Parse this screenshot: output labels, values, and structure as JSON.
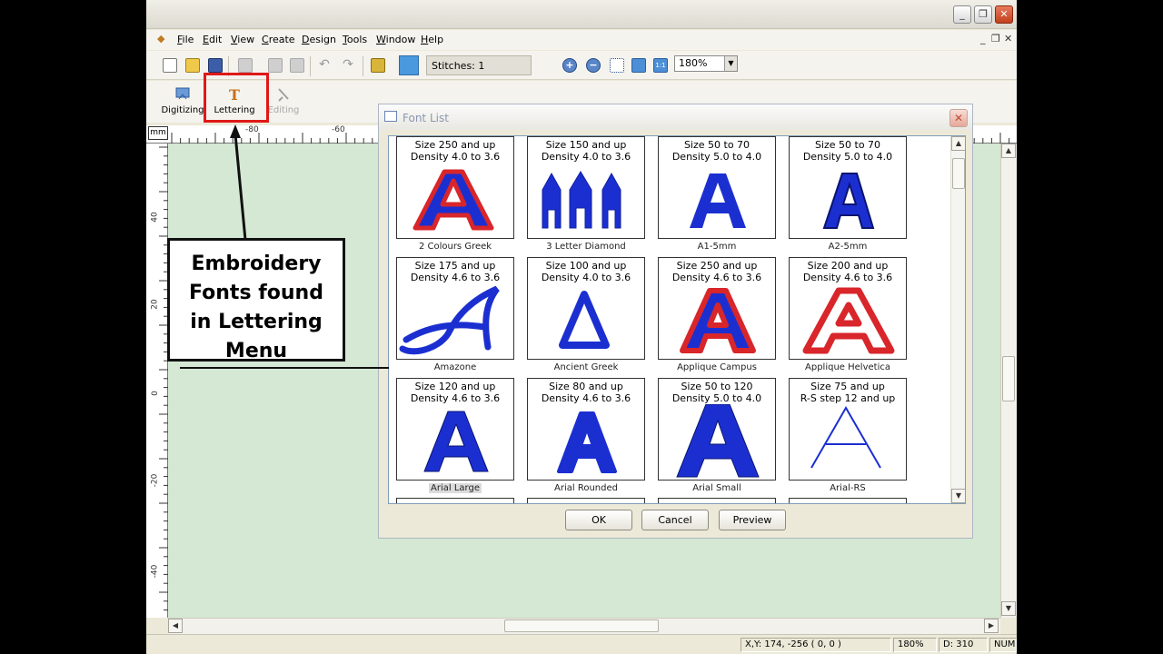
{
  "menu": [
    {
      "u": "F",
      "rest": "ile"
    },
    {
      "u": "E",
      "rest": "dit"
    },
    {
      "u": "V",
      "rest": "iew"
    },
    {
      "u": "C",
      "rest": "reate"
    },
    {
      "u": "D",
      "rest": "esign"
    },
    {
      "u": "T",
      "rest": "ools"
    },
    {
      "u": "W",
      "rest": "indow"
    },
    {
      "u": "H",
      "rest": "elp"
    }
  ],
  "toolbar": {
    "stitches_label": "Stitches: 1",
    "zoom": "180%"
  },
  "modes": [
    {
      "label": "Digitizing",
      "icon": "digitizing-icon"
    },
    {
      "label": "Lettering",
      "icon": "lettering-icon"
    },
    {
      "label": "Editing",
      "icon": "editing-icon"
    }
  ],
  "ruler": {
    "unit": "mm",
    "h_ticks": [
      "-80",
      "-60"
    ],
    "v_ticks": [
      "40",
      "20",
      "0",
      "-20",
      "-40"
    ]
  },
  "dialog": {
    "title": "Font List",
    "buttons": {
      "ok": "OK",
      "cancel": "Cancel",
      "preview": "Preview"
    },
    "fonts": [
      {
        "line1": "Size 250 and up",
        "line2": "Density 4.0 to 3.6",
        "name": "2 Colours Greek"
      },
      {
        "line1": "Size 150 and up",
        "line2": "Density 4.0 to 3.6",
        "name": "3 Letter Diamond"
      },
      {
        "line1": "Size 50 to 70",
        "line2": "Density 5.0 to 4.0",
        "name": "A1-5mm"
      },
      {
        "line1": "Size 50 to 70",
        "line2": "Density 5.0 to 4.0",
        "name": "A2-5mm"
      },
      {
        "line1": "Size 175 and up",
        "line2": "Density 4.6 to 3.6",
        "name": "Amazone"
      },
      {
        "line1": "Size 100 and up",
        "line2": "Density 4.0 to 3.6",
        "name": "Ancient Greek"
      },
      {
        "line1": "Size 250 and up",
        "line2": "Density 4.6 to 3.6",
        "name": "Applique Campus"
      },
      {
        "line1": "Size 200 and up",
        "line2": "Density 4.6 to 3.6",
        "name": "Applique Helvetica"
      },
      {
        "line1": "Size 120 and up",
        "line2": "Density 4.6 to 3.6",
        "name": "Arial Large"
      },
      {
        "line1": "Size 80 and up",
        "line2": "Density 4.6 to 3.6",
        "name": "Arial Rounded"
      },
      {
        "line1": "Size 50 to 120",
        "line2": "Density 5.0 to 4.0",
        "name": "Arial Small"
      },
      {
        "line1": "Size 75 and up",
        "line2": "R-S step 12 and up",
        "name": "Arial-RS"
      }
    ]
  },
  "callout": {
    "lines": [
      "Embroidery",
      "Fonts found",
      "in Lettering",
      "Menu"
    ]
  },
  "status": {
    "coords": "X,Y: 174, -256  ( 0, 0 )",
    "zoom": "180%",
    "d": "D: 310",
    "num": "NUM"
  },
  "colors": {
    "thread_blue": "#1b2fd1",
    "thread_red": "#d8262a",
    "highlight": "#e01818",
    "canvas": "#d4e8d4"
  }
}
